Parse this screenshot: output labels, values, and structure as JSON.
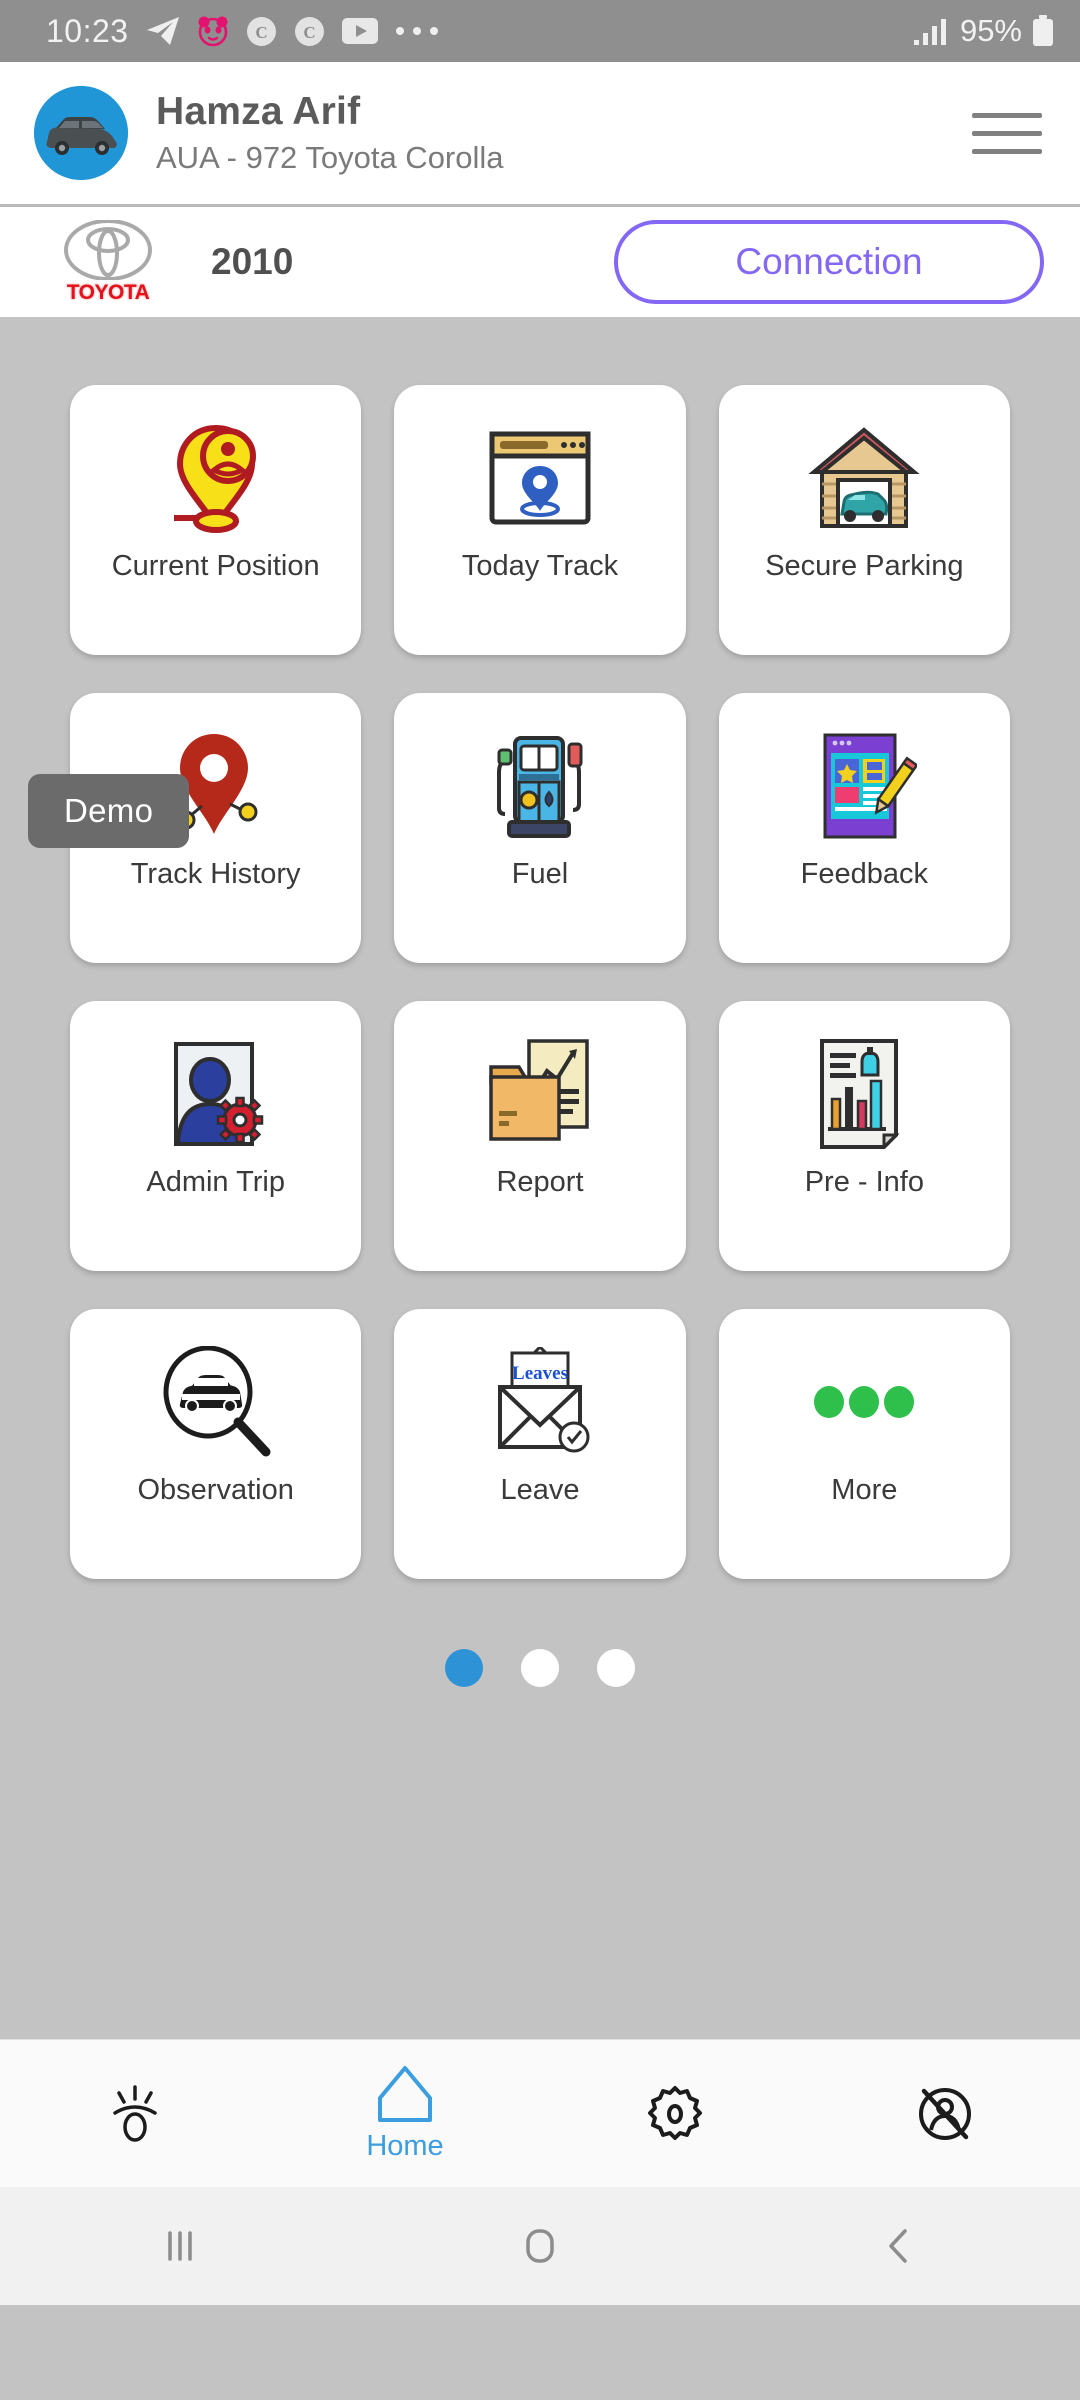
{
  "status_bar": {
    "time": "10:23",
    "battery_percent": "95%",
    "icons": [
      "telegram-icon",
      "foodpanda-icon",
      "c-app-icon",
      "c-app-icon",
      "youtube-icon",
      "more-notifications-icon"
    ],
    "signal_icon": "signal-bars-icon",
    "battery_icon": "battery-icon",
    "background_color": "#8f8f8f"
  },
  "header": {
    "user_name": "Hamza Arif",
    "vehicle_subtitle": "AUA - 972 Toyota Corolla",
    "avatar_icon": "car-avatar-icon",
    "avatar_color": "#2196d6",
    "menu_icon": "hamburger-menu-icon"
  },
  "vehicle_bar": {
    "brand_logo": "toyota-logo-icon",
    "brand_word": "TOYOTA",
    "brand_color": "#e4131b",
    "year": "2010",
    "connection_label": "Connection",
    "connection_color": "#8468f5"
  },
  "grid": {
    "tiles": [
      {
        "label": "Current Position",
        "icon": "location-pin-person-icon"
      },
      {
        "label": "Today Track",
        "icon": "browser-window-pin-icon"
      },
      {
        "label": "Secure Parking",
        "icon": "garage-car-icon"
      },
      {
        "label": "Track History",
        "icon": "route-pin-icon"
      },
      {
        "label": "Fuel",
        "icon": "fuel-pump-icon"
      },
      {
        "label": "Feedback",
        "icon": "feedback-form-pencil-icon"
      },
      {
        "label": "Admin Trip",
        "icon": "user-gear-icon"
      },
      {
        "label": "Report",
        "icon": "folder-chart-document-icon"
      },
      {
        "label": "Pre - Info",
        "icon": "document-chart-icon"
      },
      {
        "label": "Observation",
        "icon": "car-magnifier-icon"
      },
      {
        "label": "Leave",
        "icon": "envelope-leaves-icon"
      },
      {
        "label": "More",
        "icon": "three-green-dots-icon"
      }
    ]
  },
  "pagination": {
    "total": 3,
    "active_index": 0,
    "active_color": "#2e93d6",
    "inactive_color": "#ffffff"
  },
  "demo_badge": {
    "label": "Demo",
    "background_color": "#6b6b6b"
  },
  "bottom_nav": {
    "active_color": "#3c9ede",
    "items": [
      {
        "label": "",
        "icon": "alert-eye-icon",
        "active": false
      },
      {
        "label": "Home",
        "icon": "home-icon",
        "active": true
      },
      {
        "label": "",
        "icon": "settings-gear-icon",
        "active": false
      },
      {
        "label": "",
        "icon": "logout-user-off-icon",
        "active": false
      }
    ]
  },
  "android_nav": {
    "buttons": [
      {
        "icon": "recents-icon"
      },
      {
        "icon": "home-square-icon"
      },
      {
        "icon": "back-chevron-icon"
      }
    ]
  }
}
